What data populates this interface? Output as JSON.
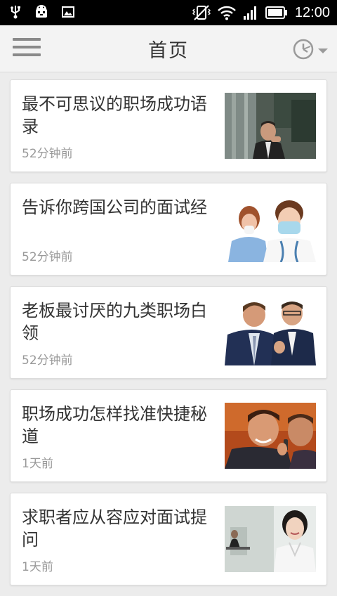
{
  "status_bar": {
    "time": "12:00",
    "icons": [
      "usb-icon",
      "android-debug-icon",
      "image-icon",
      "vibrate-off-icon",
      "wifi-icon",
      "signal-icon",
      "battery-icon"
    ]
  },
  "header": {
    "title": "首页",
    "menu_icon": "hamburger-menu-icon",
    "history_icon": "clock-dropdown-icon"
  },
  "feed": {
    "items": [
      {
        "title": "最不可思议的职场成功语录",
        "time": "52分钟前",
        "image": "businessman-photo"
      },
      {
        "title": "告诉你跨国公司的面试经",
        "time": "52分钟前",
        "image": "doctor-patient-photo"
      },
      {
        "title": "老板最讨厌的九类职场白领",
        "time": "52分钟前",
        "image": "coworkers-photo"
      },
      {
        "title": "职场成功怎样找准快捷秘道",
        "time": "1天前",
        "image": "phone-call-photo"
      },
      {
        "title": "求职者应从容应对面试提问",
        "time": "1天前",
        "image": "office-woman-photo"
      }
    ]
  },
  "colors": {
    "background": "#ececec",
    "card": "#ffffff",
    "title_text": "#333333",
    "meta_text": "#999999",
    "appbar": "#f3f3f3"
  }
}
